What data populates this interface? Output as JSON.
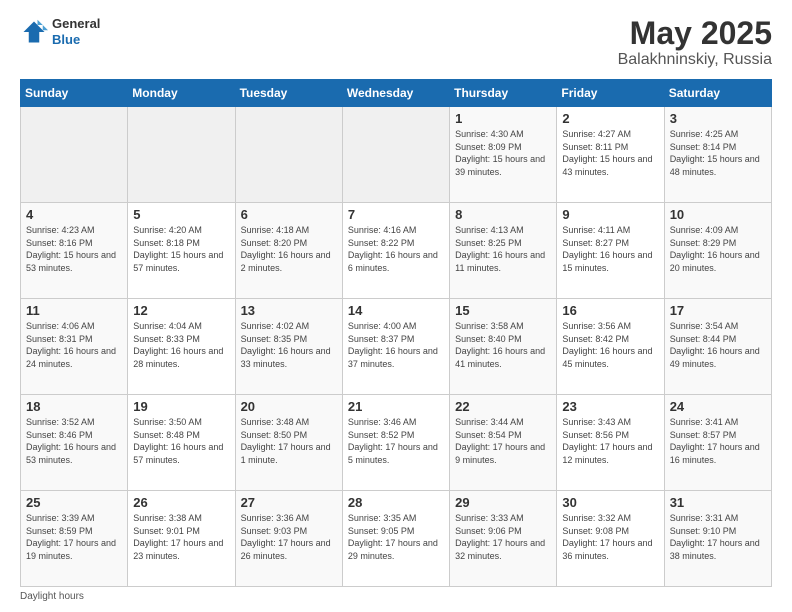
{
  "header": {
    "logo_general": "General",
    "logo_blue": "Blue",
    "title": "May 2025",
    "location": "Balakhninskiy, Russia"
  },
  "days_of_week": [
    "Sunday",
    "Monday",
    "Tuesday",
    "Wednesday",
    "Thursday",
    "Friday",
    "Saturday"
  ],
  "weeks": [
    [
      {
        "day": "",
        "empty": true
      },
      {
        "day": "",
        "empty": true
      },
      {
        "day": "",
        "empty": true
      },
      {
        "day": "",
        "empty": true
      },
      {
        "day": "1",
        "sunrise": "4:30 AM",
        "sunset": "8:09 PM",
        "daylight": "15 hours and 39 minutes."
      },
      {
        "day": "2",
        "sunrise": "4:27 AM",
        "sunset": "8:11 PM",
        "daylight": "15 hours and 43 minutes."
      },
      {
        "day": "3",
        "sunrise": "4:25 AM",
        "sunset": "8:14 PM",
        "daylight": "15 hours and 48 minutes."
      }
    ],
    [
      {
        "day": "4",
        "sunrise": "4:23 AM",
        "sunset": "8:16 PM",
        "daylight": "15 hours and 53 minutes."
      },
      {
        "day": "5",
        "sunrise": "4:20 AM",
        "sunset": "8:18 PM",
        "daylight": "15 hours and 57 minutes."
      },
      {
        "day": "6",
        "sunrise": "4:18 AM",
        "sunset": "8:20 PM",
        "daylight": "16 hours and 2 minutes."
      },
      {
        "day": "7",
        "sunrise": "4:16 AM",
        "sunset": "8:22 PM",
        "daylight": "16 hours and 6 minutes."
      },
      {
        "day": "8",
        "sunrise": "4:13 AM",
        "sunset": "8:25 PM",
        "daylight": "16 hours and 11 minutes."
      },
      {
        "day": "9",
        "sunrise": "4:11 AM",
        "sunset": "8:27 PM",
        "daylight": "16 hours and 15 minutes."
      },
      {
        "day": "10",
        "sunrise": "4:09 AM",
        "sunset": "8:29 PM",
        "daylight": "16 hours and 20 minutes."
      }
    ],
    [
      {
        "day": "11",
        "sunrise": "4:06 AM",
        "sunset": "8:31 PM",
        "daylight": "16 hours and 24 minutes."
      },
      {
        "day": "12",
        "sunrise": "4:04 AM",
        "sunset": "8:33 PM",
        "daylight": "16 hours and 28 minutes."
      },
      {
        "day": "13",
        "sunrise": "4:02 AM",
        "sunset": "8:35 PM",
        "daylight": "16 hours and 33 minutes."
      },
      {
        "day": "14",
        "sunrise": "4:00 AM",
        "sunset": "8:37 PM",
        "daylight": "16 hours and 37 minutes."
      },
      {
        "day": "15",
        "sunrise": "3:58 AM",
        "sunset": "8:40 PM",
        "daylight": "16 hours and 41 minutes."
      },
      {
        "day": "16",
        "sunrise": "3:56 AM",
        "sunset": "8:42 PM",
        "daylight": "16 hours and 45 minutes."
      },
      {
        "day": "17",
        "sunrise": "3:54 AM",
        "sunset": "8:44 PM",
        "daylight": "16 hours and 49 minutes."
      }
    ],
    [
      {
        "day": "18",
        "sunrise": "3:52 AM",
        "sunset": "8:46 PM",
        "daylight": "16 hours and 53 minutes."
      },
      {
        "day": "19",
        "sunrise": "3:50 AM",
        "sunset": "8:48 PM",
        "daylight": "16 hours and 57 minutes."
      },
      {
        "day": "20",
        "sunrise": "3:48 AM",
        "sunset": "8:50 PM",
        "daylight": "17 hours and 1 minute."
      },
      {
        "day": "21",
        "sunrise": "3:46 AM",
        "sunset": "8:52 PM",
        "daylight": "17 hours and 5 minutes."
      },
      {
        "day": "22",
        "sunrise": "3:44 AM",
        "sunset": "8:54 PM",
        "daylight": "17 hours and 9 minutes."
      },
      {
        "day": "23",
        "sunrise": "3:43 AM",
        "sunset": "8:56 PM",
        "daylight": "17 hours and 12 minutes."
      },
      {
        "day": "24",
        "sunrise": "3:41 AM",
        "sunset": "8:57 PM",
        "daylight": "17 hours and 16 minutes."
      }
    ],
    [
      {
        "day": "25",
        "sunrise": "3:39 AM",
        "sunset": "8:59 PM",
        "daylight": "17 hours and 19 minutes."
      },
      {
        "day": "26",
        "sunrise": "3:38 AM",
        "sunset": "9:01 PM",
        "daylight": "17 hours and 23 minutes."
      },
      {
        "day": "27",
        "sunrise": "3:36 AM",
        "sunset": "9:03 PM",
        "daylight": "17 hours and 26 minutes."
      },
      {
        "day": "28",
        "sunrise": "3:35 AM",
        "sunset": "9:05 PM",
        "daylight": "17 hours and 29 minutes."
      },
      {
        "day": "29",
        "sunrise": "3:33 AM",
        "sunset": "9:06 PM",
        "daylight": "17 hours and 32 minutes."
      },
      {
        "day": "30",
        "sunrise": "3:32 AM",
        "sunset": "9:08 PM",
        "daylight": "17 hours and 36 minutes."
      },
      {
        "day": "31",
        "sunrise": "3:31 AM",
        "sunset": "9:10 PM",
        "daylight": "17 hours and 38 minutes."
      }
    ]
  ],
  "footer": {
    "note": "Daylight hours"
  }
}
